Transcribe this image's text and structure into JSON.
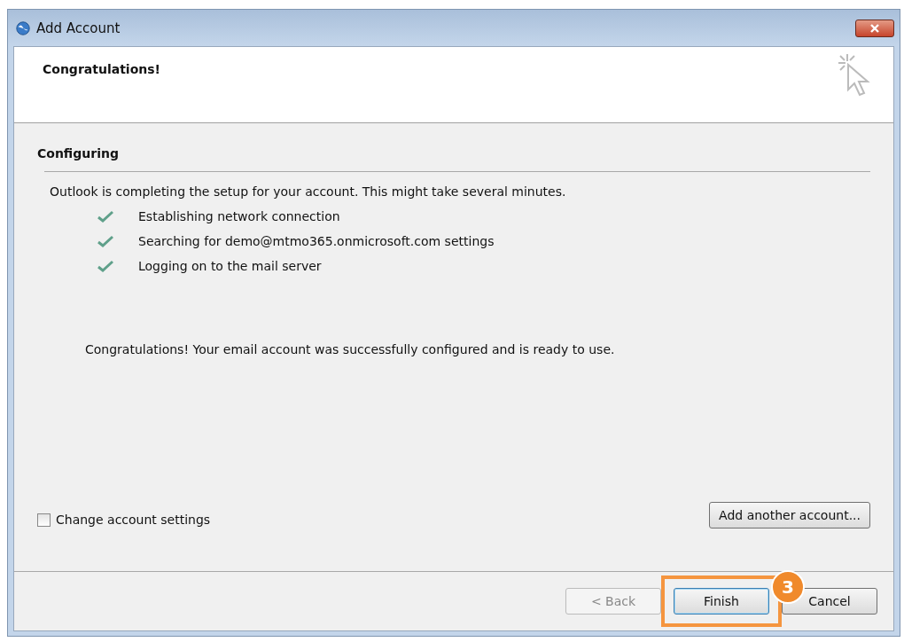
{
  "window": {
    "title": "Add Account"
  },
  "header": {
    "title": "Congratulations!"
  },
  "section": {
    "title": "Configuring",
    "intro": "Outlook is completing the setup for your account. This might take several minutes.",
    "steps": [
      {
        "label": "Establishing network connection",
        "done": true
      },
      {
        "label": "Searching for demo@mtmo365.onmicrosoft.com settings",
        "done": true
      },
      {
        "label": "Logging on to the mail server",
        "done": true
      }
    ],
    "message": "Congratulations! Your email account was successfully configured and is ready to use."
  },
  "change_settings": {
    "label": "Change account settings",
    "checked": false
  },
  "add_another_button": "Add another account...",
  "buttons": [
    {
      "label": "< Back",
      "disabled": true,
      "default": false
    },
    {
      "label": "Finish",
      "disabled": false,
      "default": true,
      "highlighted": true
    },
    {
      "label": "Cancel",
      "disabled": false,
      "default": false
    }
  ],
  "callout": {
    "number": "3"
  }
}
